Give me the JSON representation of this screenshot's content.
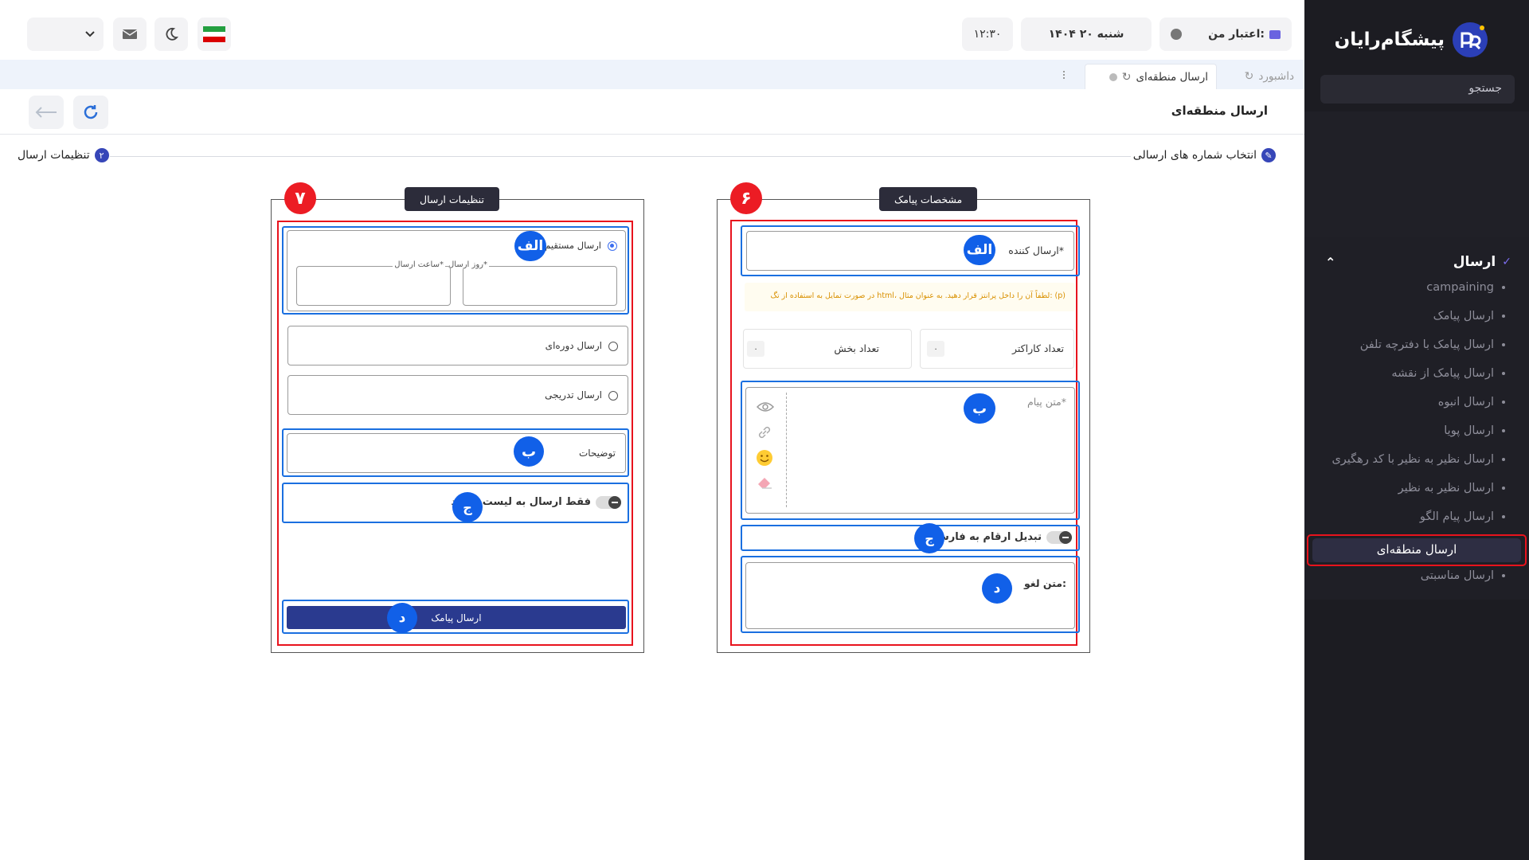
{
  "brand": {
    "name": "پیشگام‌رایان"
  },
  "colors": {
    "primary": "#2a3a8f",
    "accent": "#1160e8",
    "highlight": "#ec1c24",
    "sidebar": "#1c1c22"
  },
  "sidebar": {
    "search_label": "جستجو",
    "menu_title": "ارسال",
    "items": [
      {
        "label": "campaining"
      },
      {
        "label": "ارسال پیامک"
      },
      {
        "label": "ارسال پیامک با دفترچه تلفن"
      },
      {
        "label": "ارسال پیامک از نقشه"
      },
      {
        "label": "ارسال انبوه"
      },
      {
        "label": "ارسال پویا"
      },
      {
        "label": "ارسال نظیر به نظیر با کد رهگیری"
      },
      {
        "label": "ارسال نظیر به نظیر"
      },
      {
        "label": "ارسال پیام الگو"
      },
      {
        "label": "ارسال منطقه‌ای",
        "active": true
      },
      {
        "label": "ارسال مناسبتی"
      }
    ]
  },
  "header": {
    "credit_label": "اعتبار من:",
    "date": "شنبه ۲۰ ۱۴۰۴",
    "time": "۱۲:۳۰",
    "icons": [
      "flag-iran-icon",
      "moon-icon",
      "mail-icon",
      "chevron-down-icon"
    ]
  },
  "tabs": [
    {
      "label": "داشبورد"
    },
    {
      "label": "ارسال منطقه‌ای",
      "active": true
    }
  ],
  "page": {
    "title": "ارسال منطقه‌ای"
  },
  "steps": [
    {
      "label": "انتخاب شماره های ارسالی",
      "icon": "pencil-icon"
    },
    {
      "label": "تنظیمات ارسال",
      "number": "۲"
    }
  ],
  "sms_panel": {
    "title": "مشخصات پیامک",
    "number_badge": "۶",
    "sender_label": "ارسال کننده*",
    "html_hint": "در صورت تمایل به استفاده از تگ html، لطفاً آن را داخل پرانتز قرار دهید. به عنوان مثال: (p)",
    "char_count_label": "تعداد کاراکتر",
    "char_count_value": "۰",
    "parts_label": "تعداد بخش",
    "parts_value": "۰",
    "message_placeholder": "متن پیام*",
    "persian_digits_label": "تبدیل ارقام به فارسی",
    "cancel_text_label": "متن لغو:",
    "badges": {
      "a": "الف",
      "b": "ب",
      "c": "ج",
      "d": "د"
    },
    "tool_icons": [
      "eye-icon",
      "link-icon",
      "emoji-icon",
      "eraser-icon"
    ]
  },
  "send_panel": {
    "title": "تنظیمات ارسال",
    "number_badge": "۷",
    "direct_send_label": "ارسال مستقیم",
    "send_day_label": "روز ارسال*",
    "send_time_label": "ساعت ارسال*",
    "periodic_send_label": "ارسال دوره‌ای",
    "gradual_send_label": "ارسال تدریجی",
    "description_label": "توضیحات",
    "whitelist_label": "فقط ارسال به لیست سفید",
    "submit_label": "ارسال پیامک",
    "badges": {
      "a": "الف",
      "b": "ب",
      "c": "ج",
      "d": "د"
    }
  }
}
